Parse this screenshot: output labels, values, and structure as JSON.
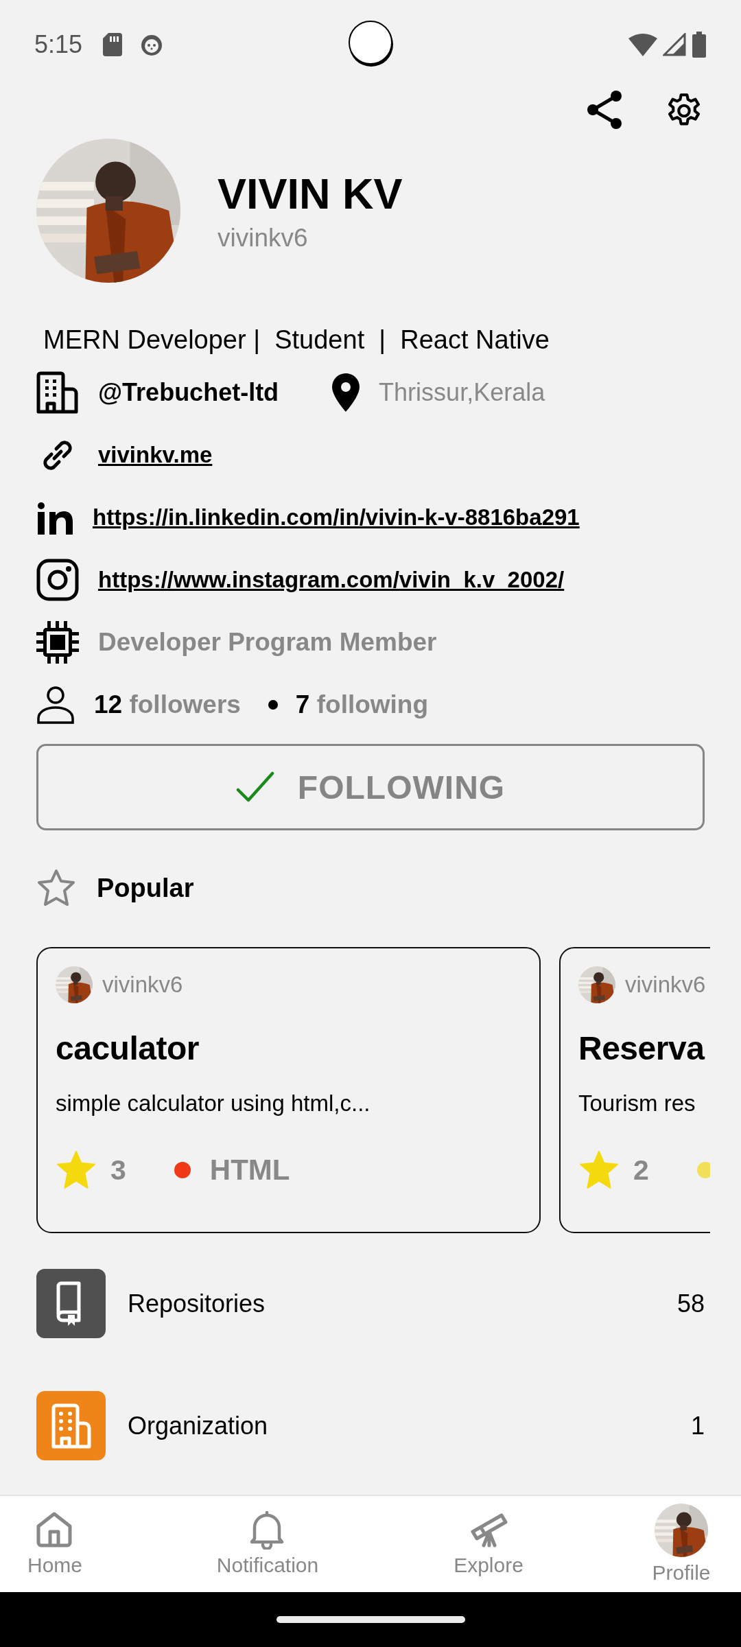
{
  "status_bar": {
    "time": "5:15"
  },
  "profile": {
    "name": "VIVIN KV",
    "username": "vivinkv6",
    "bio": "MERN Developer |  Student  |  React Native",
    "company": "@Trebuchet-ltd",
    "location": "Thrissur,Kerala",
    "links": [
      {
        "kind": "website",
        "text": "vivinkv.me"
      },
      {
        "kind": "linkedin",
        "text": "https://in.linkedin.com/in/vivin-k-v-8816ba291"
      },
      {
        "kind": "instagram",
        "text": "https://www.instagram.com/vivin_k.v_2002/"
      }
    ],
    "badge": "Developer Program Member",
    "followers": {
      "count": "12",
      "label": "followers"
    },
    "following": {
      "count": "7",
      "label": "following"
    }
  },
  "follow_button": {
    "label": "FOLLOWING",
    "following": true
  },
  "popular": {
    "title": "Popular",
    "repos": [
      {
        "owner": "vivinkv6",
        "name": "caculator",
        "description": "simple calculator using html,c...",
        "stars": "3",
        "language": "HTML",
        "color": "#f03a17"
      },
      {
        "owner": "vivinkv6",
        "name": "Reserva",
        "description": "Tourism res",
        "stars": "2",
        "color": "#f1e05a"
      }
    ]
  },
  "menu": [
    {
      "kind": "repositories",
      "label": "Repositories",
      "count": "58",
      "color": "#505050"
    },
    {
      "kind": "organization",
      "label": "Organization",
      "count": "1",
      "color": "#ef8519"
    }
  ],
  "nav": [
    {
      "kind": "home",
      "label": "Home"
    },
    {
      "kind": "notification",
      "label": "Notification"
    },
    {
      "kind": "explore",
      "label": "Explore"
    },
    {
      "kind": "profile",
      "label": "Profile"
    }
  ]
}
